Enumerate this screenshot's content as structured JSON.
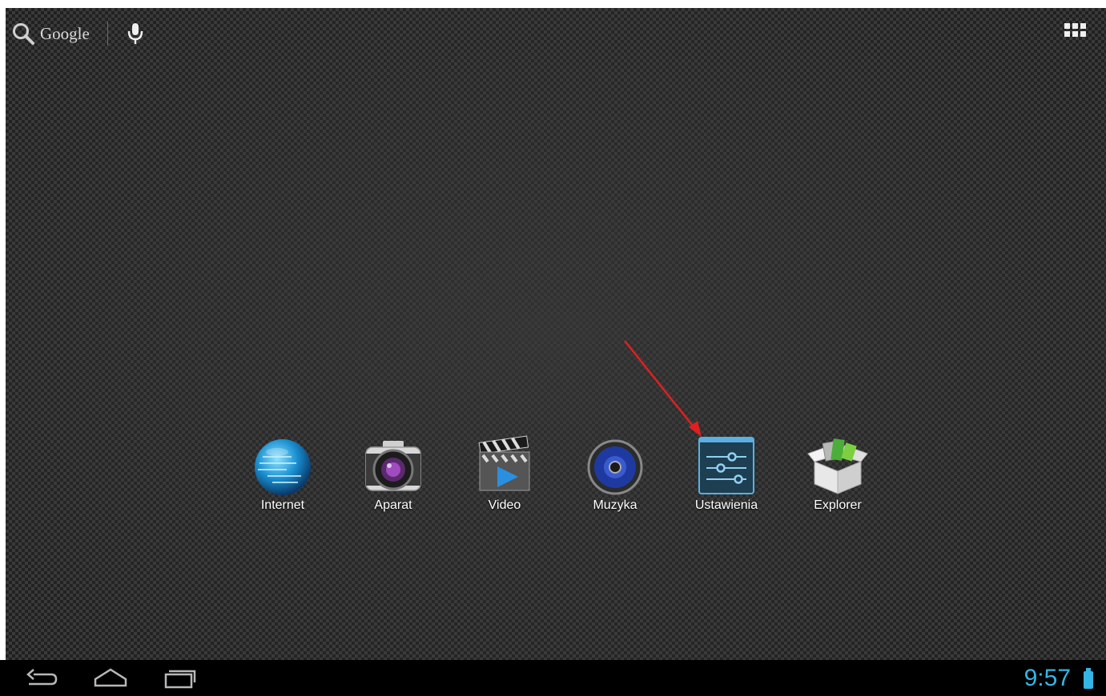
{
  "search": {
    "label": "Google"
  },
  "dock": {
    "apps": [
      {
        "label": "Internet",
        "icon": "globe-icon"
      },
      {
        "label": "Aparat",
        "icon": "camera-icon"
      },
      {
        "label": "Video",
        "icon": "video-icon"
      },
      {
        "label": "Muzyka",
        "icon": "music-icon"
      },
      {
        "label": "Ustawienia",
        "icon": "settings-icon"
      },
      {
        "label": "Explorer",
        "icon": "explorer-icon"
      }
    ]
  },
  "statusbar": {
    "time": "9:57"
  },
  "colors": {
    "accent": "#33b5e5",
    "annotation": "#e02020"
  }
}
